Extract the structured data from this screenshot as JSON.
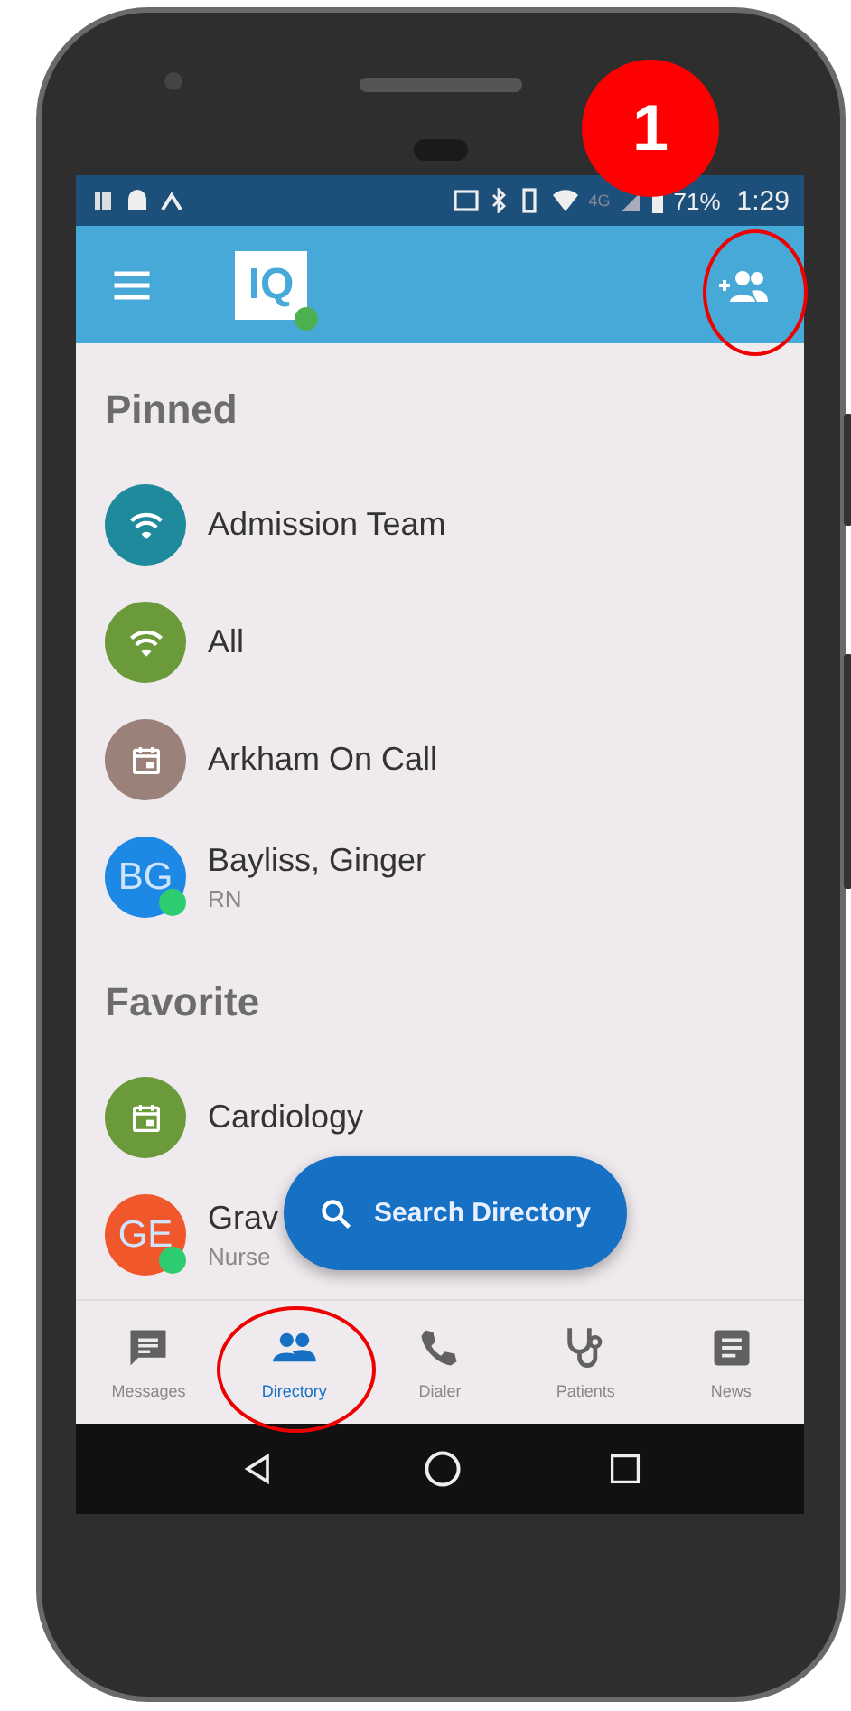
{
  "annotation": {
    "step": "1"
  },
  "status_bar": {
    "network": "4G",
    "battery": "71%",
    "time": "1:29"
  },
  "app_bar": {
    "logo": "IQ"
  },
  "sections": [
    {
      "title": "Pinned",
      "items": [
        {
          "kind": "group",
          "name": "Admission Team",
          "color": "#1e8a9c",
          "online": false
        },
        {
          "kind": "group",
          "name": "All",
          "color": "#6a9a3a",
          "online": false
        },
        {
          "kind": "calendar",
          "name": "Arkham On Call",
          "color": "#9a8179",
          "online": false
        },
        {
          "kind": "person",
          "name": "Bayliss, Ginger",
          "subtitle": "RN",
          "initials": "BG",
          "color": "#1e88e5",
          "online": true
        }
      ]
    },
    {
      "title": "Favorite",
      "items": [
        {
          "kind": "calendar",
          "name": "Cardiology",
          "color": "#6a9a3a",
          "online": false
        },
        {
          "kind": "person",
          "name": "Grav",
          "subtitle": "Nurse",
          "initials": "GE",
          "color": "#f0582b",
          "online": true
        }
      ]
    }
  ],
  "fab": {
    "label": "Search Directory"
  },
  "tabs": [
    {
      "kind": "messages",
      "label": "Messages",
      "selected": false
    },
    {
      "kind": "directory",
      "label": "Directory",
      "selected": true
    },
    {
      "kind": "dialer",
      "label": "Dialer",
      "selected": false
    },
    {
      "kind": "patients",
      "label": "Patients",
      "selected": false
    },
    {
      "kind": "news",
      "label": "News",
      "selected": false
    }
  ]
}
